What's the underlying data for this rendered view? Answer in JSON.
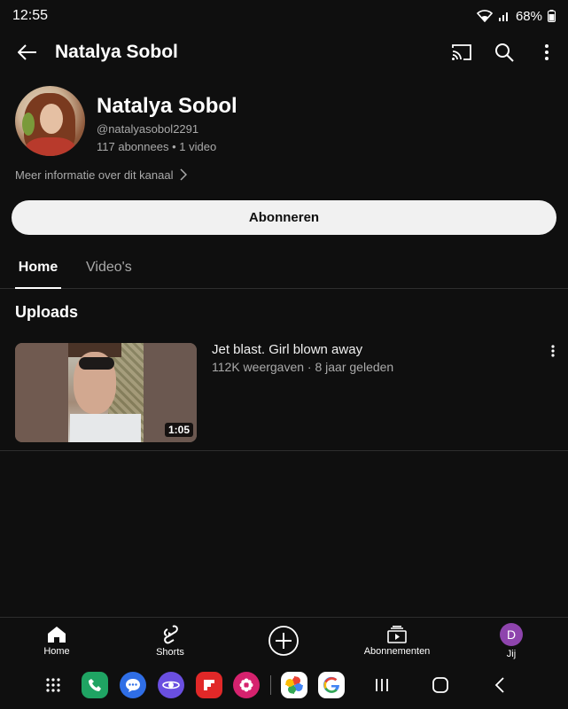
{
  "status_bar": {
    "time": "12:55",
    "battery": "68%"
  },
  "app_bar": {
    "title": "Natalya Sobol"
  },
  "channel": {
    "name": "Natalya Sobol",
    "handle": "@natalyasobol2291",
    "subscribers": "117 abonnees",
    "separator": "•",
    "video_count": "1 video",
    "more_info": "Meer informatie over dit kanaal"
  },
  "subscribe_label": "Abonneren",
  "tabs": [
    {
      "label": "Home",
      "selected": true
    },
    {
      "label": "Video's",
      "selected": false
    }
  ],
  "section_title": "Uploads",
  "videos": [
    {
      "title": "Jet blast. Girl blown away",
      "meta": "112K weergaven · 8 jaar geleden",
      "duration": "1:05"
    }
  ],
  "bottom_nav": [
    {
      "label": "Home",
      "icon": "home-icon"
    },
    {
      "label": "Shorts",
      "icon": "shorts-icon"
    },
    {
      "label": "",
      "icon": "create-icon"
    },
    {
      "label": "Abonnementen",
      "icon": "subscriptions-icon"
    },
    {
      "label": "Jij",
      "icon": "account-avatar",
      "avatar_letter": "D"
    }
  ],
  "dock_apps": [
    "app-drawer-icon",
    "phone-app-icon",
    "messages-app-icon",
    "internet-app-icon",
    "flipboard-app-icon",
    "gallery-app-icon",
    "photos-app-icon",
    "google-app-icon"
  ],
  "system_nav": [
    "recents-button",
    "home-button",
    "back-button"
  ],
  "colors": {
    "background": "#0f0f0f",
    "accent_avatar": "#8e44ad",
    "text_secondary": "#aaaaaa"
  }
}
